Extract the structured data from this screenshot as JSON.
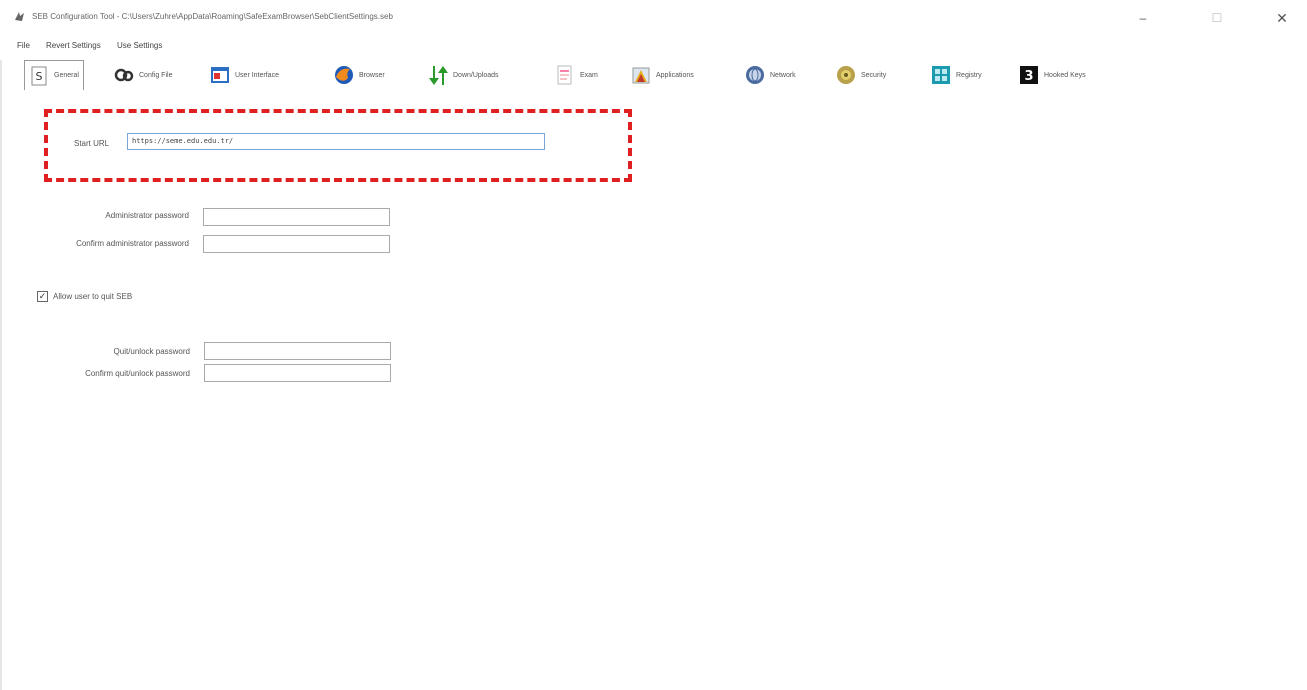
{
  "window": {
    "title": "SEB Configuration Tool - C:\\Users\\Zuhre\\AppData\\Roaming\\SafeExamBrowser\\SebClientSettings.seb",
    "minimize_glyph": "–",
    "maximize_glyph": "☐",
    "close_glyph": "✕"
  },
  "menu": {
    "items": [
      "File",
      "Revert Settings",
      "Use Settings"
    ]
  },
  "tabs": [
    {
      "label": "General",
      "icon": "general-icon"
    },
    {
      "label": "Config File",
      "icon": "config-file-icon"
    },
    {
      "label": "User Interface",
      "icon": "user-interface-icon"
    },
    {
      "label": "Browser",
      "icon": "browser-icon"
    },
    {
      "label": "Down/Uploads",
      "icon": "down-uploads-icon"
    },
    {
      "label": "Exam",
      "icon": "exam-icon"
    },
    {
      "label": "Applications",
      "icon": "applications-icon"
    },
    {
      "label": "Network",
      "icon": "network-icon"
    },
    {
      "label": "Security",
      "icon": "security-icon"
    },
    {
      "label": "Registry",
      "icon": "registry-icon"
    },
    {
      "label": "Hooked Keys",
      "icon": "hooked-keys-icon"
    }
  ],
  "general": {
    "start_url_label": "Start URL",
    "start_url_value": "https://seme.edu.edu.tr/",
    "admin_password_label": "Administrator password",
    "confirm_admin_password_label": "Confirm administrator password",
    "allow_quit_label": "Allow user to quit SEB",
    "allow_quit_checked": true,
    "quit_password_label": "Quit/unlock password",
    "confirm_quit_password_label": "Confirm quit/unlock password"
  },
  "colors": {
    "highlight": "#e02020",
    "input_focus_border": "#7aa6d8"
  }
}
